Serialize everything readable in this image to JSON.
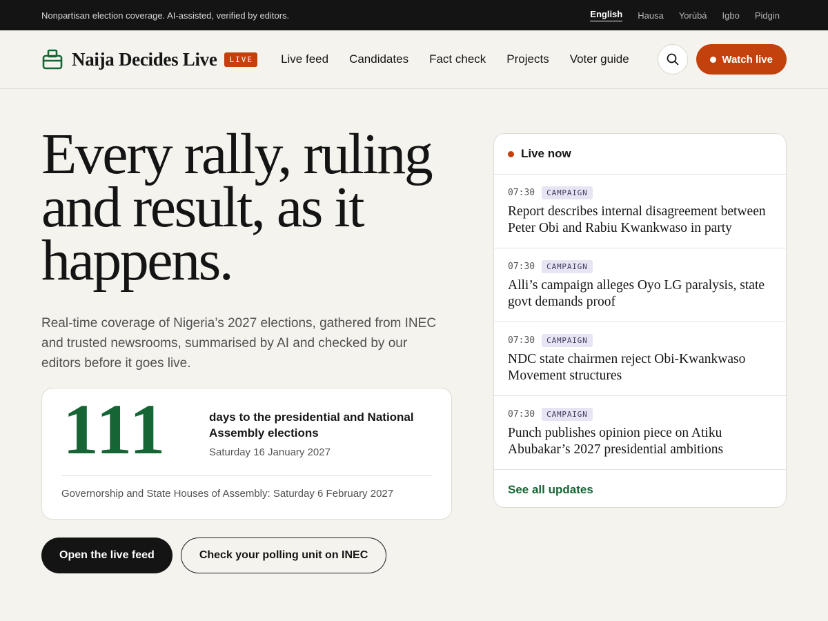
{
  "topbar": {
    "tagline": "Nonpartisan election coverage. AI-assisted, verified by editors.",
    "languages": [
      {
        "label": "English",
        "active": true
      },
      {
        "label": "Hausa"
      },
      {
        "label": "Yorùbá"
      },
      {
        "label": "Igbo"
      },
      {
        "label": "Pidgin"
      }
    ]
  },
  "header": {
    "brand": "Naija Decides Live",
    "live_tag": "LIVE",
    "nav": [
      "Live feed",
      "Candidates",
      "Fact check",
      "Projects",
      "Voter guide"
    ],
    "watch_label": "Watch live"
  },
  "hero": {
    "title_lines": [
      "Every rally, ruling",
      "and result, as it",
      "happens."
    ],
    "lede": "Real-time coverage of Nigeria’s 2027 elections, gathered from INEC and trusted newsrooms, summarised by AI and checked by our editors before it goes live."
  },
  "countdown": {
    "days": "111",
    "label": "days to the presidential and National Assembly elections",
    "date": "Saturday 16 January 2027",
    "note": "Governorship and State Houses of Assembly: Saturday 6 February 2027"
  },
  "cta": {
    "primary": "Open the live feed",
    "secondary": "Check your polling unit on INEC"
  },
  "live": {
    "title": "Live now",
    "items": [
      {
        "time": "07:30",
        "tag": "CAMPAIGN",
        "headline": "Report describes internal disagreement between Peter Obi and Rabiu Kwankwaso in party"
      },
      {
        "time": "07:30",
        "tag": "CAMPAIGN",
        "headline": "Alli’s campaign alleges Oyo LG paralysis, state govt demands proof"
      },
      {
        "time": "07:30",
        "tag": "CAMPAIGN",
        "headline": "NDC state chairmen reject Obi-Kwankwaso Movement structures"
      },
      {
        "time": "07:30",
        "tag": "CAMPAIGN",
        "headline": "Punch publishes opinion piece on Atiku Abubakar’s 2027 presidential ambitions"
      }
    ],
    "see_all": "See all updates"
  },
  "colors": {
    "accent": "#c2410c",
    "brand_green": "#166534",
    "tag_bg": "#e7e5f3",
    "dark": "#141414",
    "background": "#f5f3ee"
  },
  "icons": {
    "brand": "ballot-box-icon",
    "search": "search-icon",
    "live": "live-dot-icon"
  }
}
